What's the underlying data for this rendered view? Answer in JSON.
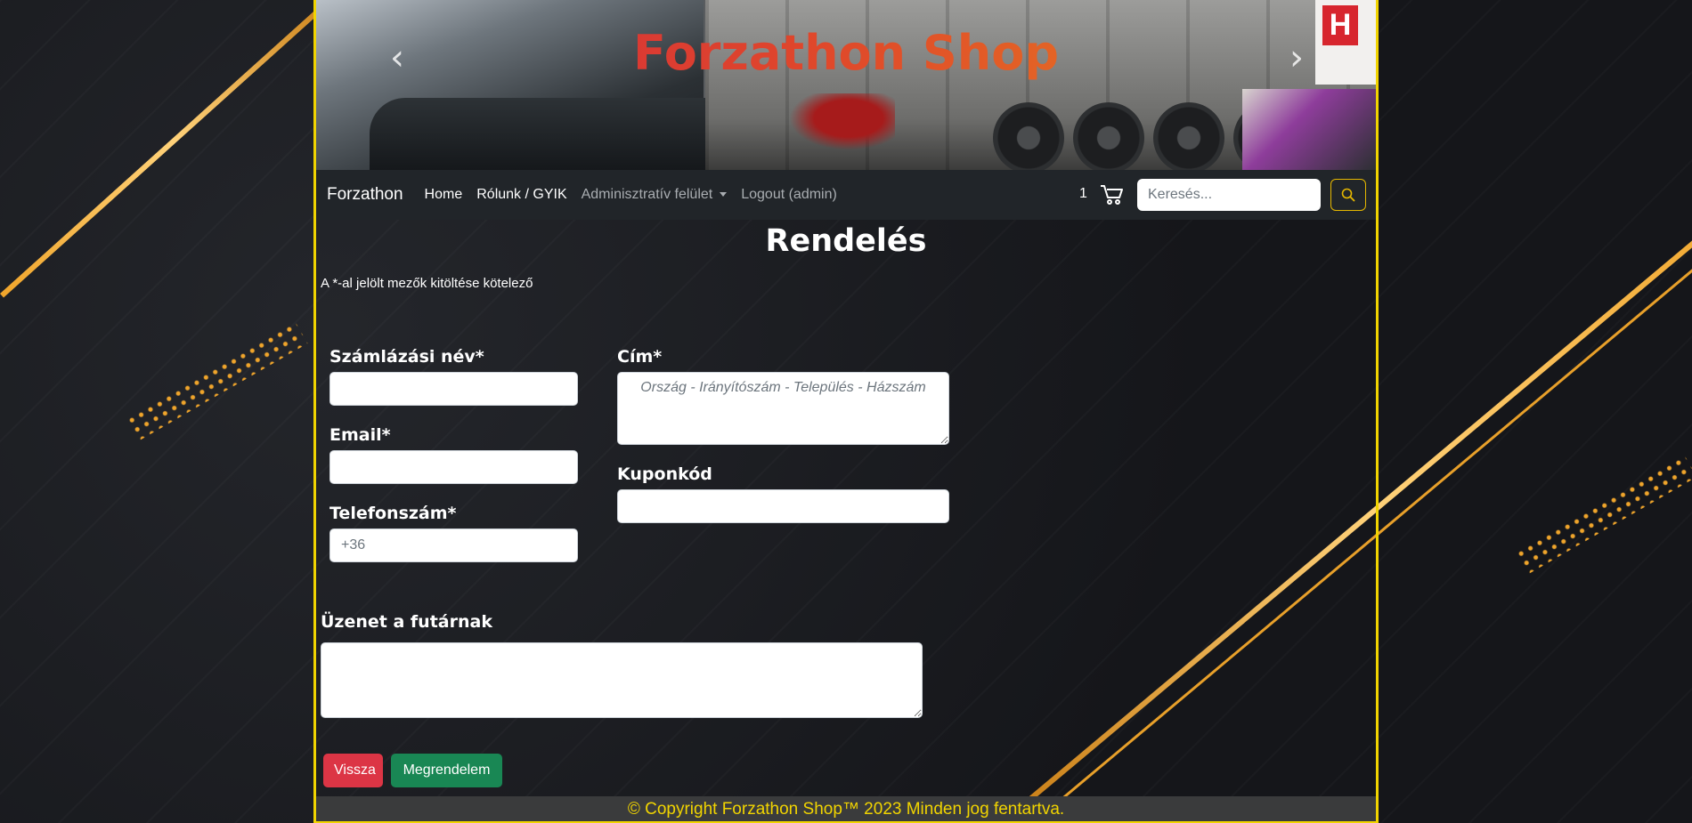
{
  "hero": {
    "title": "Forzathon Shop",
    "prev_icon": "chevron-left-icon",
    "next_icon": "chevron-right-icon",
    "sign_letter": "H"
  },
  "navbar": {
    "brand": "Forzathon",
    "links": [
      {
        "label": "Home"
      },
      {
        "label": "Rólunk / GYIK"
      },
      {
        "label": "Adminisztratív felület"
      },
      {
        "label": "Logout (admin)"
      }
    ],
    "cart_count": "1",
    "cart_icon": "cart-icon",
    "search_placeholder": "Keresés...",
    "search_icon": "search-icon"
  },
  "form": {
    "title": "Rendelés",
    "required_note": "A *-al jelölt mezők kitöltése kötelező",
    "billing_name_label": "Számlázási név*",
    "billing_name_value": "",
    "email_label": "Email*",
    "email_value": "",
    "phone_label": "Telefonszám*",
    "phone_placeholder": "+36",
    "address_label": "Cím*",
    "address_placeholder": "Ország - Irányítószám - Település - Házszám",
    "coupon_label": "Kuponkód",
    "coupon_value": "",
    "message_label": "Üzenet a futárnak",
    "message_value": "",
    "back_label": "Vissza",
    "order_label": "Megrendelem"
  },
  "footer": {
    "text": "© Copyright Forzathon Shop™ 2023 Minden jog fentartva."
  },
  "colors": {
    "accent_yellow": "#f1d400",
    "navbar_bg": "#212529",
    "danger": "#dc3545",
    "success": "#198754"
  }
}
